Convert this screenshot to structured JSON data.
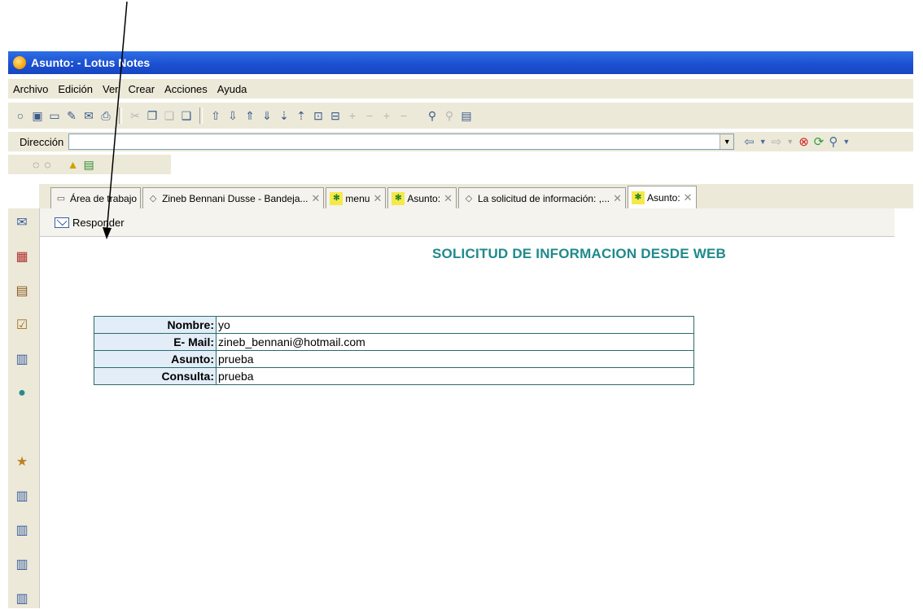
{
  "window": {
    "title": "Asunto:  - Lotus Notes"
  },
  "menu": [
    "Archivo",
    "Edición",
    "Ver",
    "Crear",
    "Acciones",
    "Ayuda"
  ],
  "address": {
    "label": "Dirección",
    "value": ""
  },
  "tabs": [
    {
      "label": "Área de trabajo",
      "icon": "workspace-icon"
    },
    {
      "label": "Zineb Bennani Dusse - Bandeja...",
      "icon": "mail-icon"
    },
    {
      "label": "menu",
      "icon": "web-icon"
    },
    {
      "label": "Asunto:",
      "icon": "web-document-icon"
    },
    {
      "label": "La solicitud de información: ,...",
      "icon": "mail-icon"
    },
    {
      "label": "Asunto:",
      "icon": "web-document-icon",
      "active": true
    }
  ],
  "action": {
    "reply_label": "Responder"
  },
  "form": {
    "title": "SOLICITUD DE INFORMACION DESDE WEB",
    "rows": [
      {
        "label": "Nombre:",
        "value": "yo"
      },
      {
        "label": "E- Mail:",
        "value": "zineb_bennani@hotmail.com"
      },
      {
        "label": "Asunto:",
        "value": "prueba"
      },
      {
        "label": "Consulta:",
        "value": "prueba"
      }
    ]
  },
  "colors": {
    "title_bar": "#1a4fd0",
    "form_title": "#1f8a8a",
    "label_bg": "#e2edf7",
    "table_border": "#2a6b6b"
  }
}
